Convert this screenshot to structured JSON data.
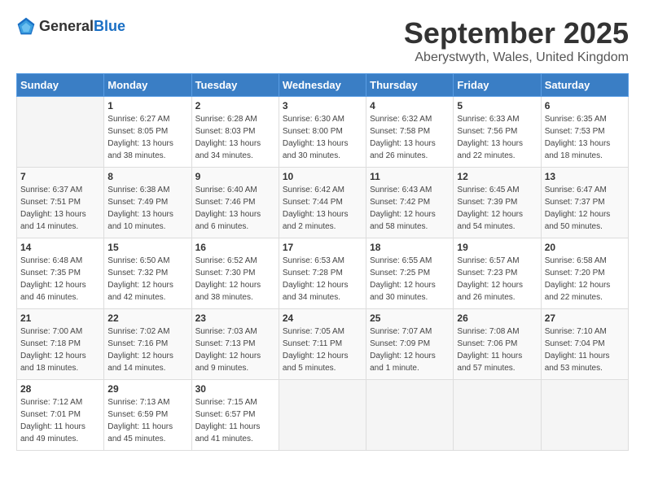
{
  "logo": {
    "text_general": "General",
    "text_blue": "Blue"
  },
  "title": "September 2025",
  "location": "Aberystwyth, Wales, United Kingdom",
  "headers": [
    "Sunday",
    "Monday",
    "Tuesday",
    "Wednesday",
    "Thursday",
    "Friday",
    "Saturday"
  ],
  "weeks": [
    [
      {
        "day": "",
        "sunrise": "",
        "sunset": "",
        "daylight": ""
      },
      {
        "day": "1",
        "sunrise": "Sunrise: 6:27 AM",
        "sunset": "Sunset: 8:05 PM",
        "daylight": "Daylight: 13 hours and 38 minutes."
      },
      {
        "day": "2",
        "sunrise": "Sunrise: 6:28 AM",
        "sunset": "Sunset: 8:03 PM",
        "daylight": "Daylight: 13 hours and 34 minutes."
      },
      {
        "day": "3",
        "sunrise": "Sunrise: 6:30 AM",
        "sunset": "Sunset: 8:00 PM",
        "daylight": "Daylight: 13 hours and 30 minutes."
      },
      {
        "day": "4",
        "sunrise": "Sunrise: 6:32 AM",
        "sunset": "Sunset: 7:58 PM",
        "daylight": "Daylight: 13 hours and 26 minutes."
      },
      {
        "day": "5",
        "sunrise": "Sunrise: 6:33 AM",
        "sunset": "Sunset: 7:56 PM",
        "daylight": "Daylight: 13 hours and 22 minutes."
      },
      {
        "day": "6",
        "sunrise": "Sunrise: 6:35 AM",
        "sunset": "Sunset: 7:53 PM",
        "daylight": "Daylight: 13 hours and 18 minutes."
      }
    ],
    [
      {
        "day": "7",
        "sunrise": "Sunrise: 6:37 AM",
        "sunset": "Sunset: 7:51 PM",
        "daylight": "Daylight: 13 hours and 14 minutes."
      },
      {
        "day": "8",
        "sunrise": "Sunrise: 6:38 AM",
        "sunset": "Sunset: 7:49 PM",
        "daylight": "Daylight: 13 hours and 10 minutes."
      },
      {
        "day": "9",
        "sunrise": "Sunrise: 6:40 AM",
        "sunset": "Sunset: 7:46 PM",
        "daylight": "Daylight: 13 hours and 6 minutes."
      },
      {
        "day": "10",
        "sunrise": "Sunrise: 6:42 AM",
        "sunset": "Sunset: 7:44 PM",
        "daylight": "Daylight: 13 hours and 2 minutes."
      },
      {
        "day": "11",
        "sunrise": "Sunrise: 6:43 AM",
        "sunset": "Sunset: 7:42 PM",
        "daylight": "Daylight: 12 hours and 58 minutes."
      },
      {
        "day": "12",
        "sunrise": "Sunrise: 6:45 AM",
        "sunset": "Sunset: 7:39 PM",
        "daylight": "Daylight: 12 hours and 54 minutes."
      },
      {
        "day": "13",
        "sunrise": "Sunrise: 6:47 AM",
        "sunset": "Sunset: 7:37 PM",
        "daylight": "Daylight: 12 hours and 50 minutes."
      }
    ],
    [
      {
        "day": "14",
        "sunrise": "Sunrise: 6:48 AM",
        "sunset": "Sunset: 7:35 PM",
        "daylight": "Daylight: 12 hours and 46 minutes."
      },
      {
        "day": "15",
        "sunrise": "Sunrise: 6:50 AM",
        "sunset": "Sunset: 7:32 PM",
        "daylight": "Daylight: 12 hours and 42 minutes."
      },
      {
        "day": "16",
        "sunrise": "Sunrise: 6:52 AM",
        "sunset": "Sunset: 7:30 PM",
        "daylight": "Daylight: 12 hours and 38 minutes."
      },
      {
        "day": "17",
        "sunrise": "Sunrise: 6:53 AM",
        "sunset": "Sunset: 7:28 PM",
        "daylight": "Daylight: 12 hours and 34 minutes."
      },
      {
        "day": "18",
        "sunrise": "Sunrise: 6:55 AM",
        "sunset": "Sunset: 7:25 PM",
        "daylight": "Daylight: 12 hours and 30 minutes."
      },
      {
        "day": "19",
        "sunrise": "Sunrise: 6:57 AM",
        "sunset": "Sunset: 7:23 PM",
        "daylight": "Daylight: 12 hours and 26 minutes."
      },
      {
        "day": "20",
        "sunrise": "Sunrise: 6:58 AM",
        "sunset": "Sunset: 7:20 PM",
        "daylight": "Daylight: 12 hours and 22 minutes."
      }
    ],
    [
      {
        "day": "21",
        "sunrise": "Sunrise: 7:00 AM",
        "sunset": "Sunset: 7:18 PM",
        "daylight": "Daylight: 12 hours and 18 minutes."
      },
      {
        "day": "22",
        "sunrise": "Sunrise: 7:02 AM",
        "sunset": "Sunset: 7:16 PM",
        "daylight": "Daylight: 12 hours and 14 minutes."
      },
      {
        "day": "23",
        "sunrise": "Sunrise: 7:03 AM",
        "sunset": "Sunset: 7:13 PM",
        "daylight": "Daylight: 12 hours and 9 minutes."
      },
      {
        "day": "24",
        "sunrise": "Sunrise: 7:05 AM",
        "sunset": "Sunset: 7:11 PM",
        "daylight": "Daylight: 12 hours and 5 minutes."
      },
      {
        "day": "25",
        "sunrise": "Sunrise: 7:07 AM",
        "sunset": "Sunset: 7:09 PM",
        "daylight": "Daylight: 12 hours and 1 minute."
      },
      {
        "day": "26",
        "sunrise": "Sunrise: 7:08 AM",
        "sunset": "Sunset: 7:06 PM",
        "daylight": "Daylight: 11 hours and 57 minutes."
      },
      {
        "day": "27",
        "sunrise": "Sunrise: 7:10 AM",
        "sunset": "Sunset: 7:04 PM",
        "daylight": "Daylight: 11 hours and 53 minutes."
      }
    ],
    [
      {
        "day": "28",
        "sunrise": "Sunrise: 7:12 AM",
        "sunset": "Sunset: 7:01 PM",
        "daylight": "Daylight: 11 hours and 49 minutes."
      },
      {
        "day": "29",
        "sunrise": "Sunrise: 7:13 AM",
        "sunset": "Sunset: 6:59 PM",
        "daylight": "Daylight: 11 hours and 45 minutes."
      },
      {
        "day": "30",
        "sunrise": "Sunrise: 7:15 AM",
        "sunset": "Sunset: 6:57 PM",
        "daylight": "Daylight: 11 hours and 41 minutes."
      },
      {
        "day": "",
        "sunrise": "",
        "sunset": "",
        "daylight": ""
      },
      {
        "day": "",
        "sunrise": "",
        "sunset": "",
        "daylight": ""
      },
      {
        "day": "",
        "sunrise": "",
        "sunset": "",
        "daylight": ""
      },
      {
        "day": "",
        "sunrise": "",
        "sunset": "",
        "daylight": ""
      }
    ]
  ]
}
